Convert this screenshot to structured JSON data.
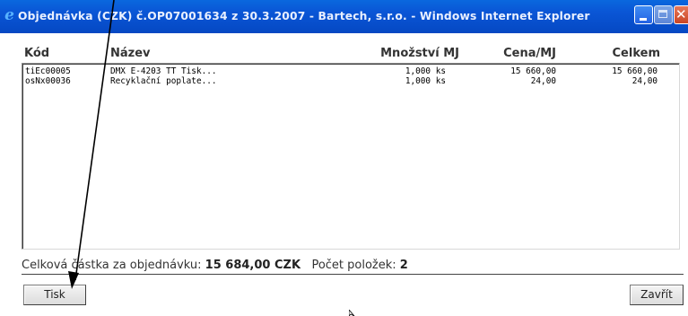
{
  "window": {
    "title": "Objednávka (CZK) č.OP07001634 z 30.3.2007 - Bartech, s.r.o. - Windows Internet Explorer",
    "app_icon": "internet-explorer-icon"
  },
  "table": {
    "columns": {
      "code": "Kód",
      "name": "Název",
      "qty": "Množství MJ",
      "price": "Cena/MJ",
      "total": "Celkem"
    },
    "rows": [
      {
        "code": "tiEc00005",
        "name": "DMX E-4203 TT Tisk...",
        "qty": "1,000 ks",
        "price": "15 660,00",
        "total": "15 660,00"
      },
      {
        "code": "osNx00036",
        "name": "Recyklační poplate...",
        "qty": "1,000 ks",
        "price": "24,00",
        "total": "24,00"
      }
    ]
  },
  "summary": {
    "total_label": "Celková částka za objednávku:",
    "total_value": "15 684,00 CZK",
    "count_label": "Počet položek:",
    "count_value": "2"
  },
  "buttons": {
    "print": "Tisk",
    "close": "Zavřít"
  },
  "colors": {
    "titlebar": "#0a56d6",
    "header_text": "#333333"
  }
}
